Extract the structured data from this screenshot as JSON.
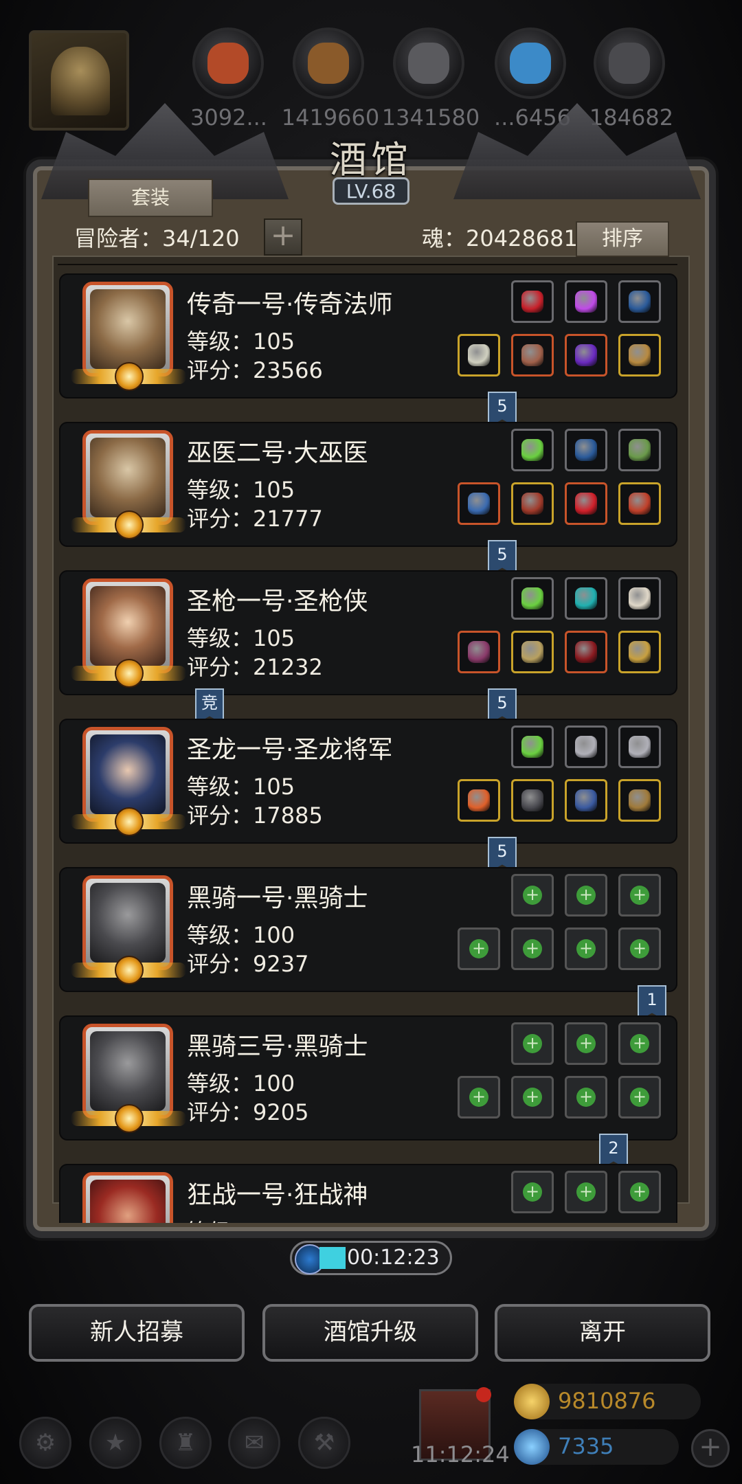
{
  "resources": {
    "values": [
      "3092...",
      "1419660",
      "1341580",
      "...6456",
      "184682"
    ],
    "colors": [
      "#b34a28",
      "#8a5a2a",
      "#5a5a5e",
      "#3c8ac8",
      "#4a4a4e"
    ]
  },
  "tavern": {
    "title": "酒馆",
    "level": "LV.68",
    "tab_label": "套装",
    "adventurer_count": "冒险者：34/120",
    "add_label": "+",
    "soul": "魂：20428681",
    "sort_label": "排序"
  },
  "heroes": [
    {
      "name": "传奇一号·传奇法师",
      "level": "等级：105",
      "score": "评分：23566",
      "face": "old-mage",
      "slots_top": [
        "ruby-necklace",
        "purple-gem",
        "blue-bow"
      ],
      "slots_bottom": [
        "silver-staff",
        "armor",
        "amulet",
        "ring"
      ],
      "ribbon_right": "5"
    },
    {
      "name": "巫医二号·大巫医",
      "level": "等级：105",
      "score": "评分：21777",
      "face": "old-mage",
      "slots_top": [
        "green-crystal",
        "blue-bow",
        "green-leaf"
      ],
      "slots_bottom": [
        "wand",
        "red-armor",
        "red-potion",
        "red-ring"
      ],
      "ribbon_right": "5"
    },
    {
      "name": "圣枪一号·圣枪侠",
      "level": "等级：105",
      "score": "评分：21232",
      "face": "gunslinger",
      "slots_top": [
        "green-crystal",
        "teal-stone",
        "white-feather"
      ],
      "slots_bottom": [
        "rifle",
        "helmet",
        "red-claw",
        "gold-ring"
      ],
      "ribbon_left": "竞",
      "ribbon_right": "5"
    },
    {
      "name": "圣龙一号·圣龙将军",
      "level": "等级：105",
      "score": "评分：17885",
      "face": "general",
      "slots_top": [
        "green-crystal",
        "dagger",
        "dagger"
      ],
      "slots_bottom": [
        "flame-sword",
        "dark-armor",
        "pendant",
        "shield"
      ],
      "ribbon_right": "5"
    },
    {
      "name": "黑骑一号·黑骑士",
      "level": "等级：100",
      "score": "评分：9237",
      "face": "knight",
      "empty": true,
      "ribbon_right": "1"
    },
    {
      "name": "黑骑三号·黑骑士",
      "level": "等级：100",
      "score": "评分：9205",
      "face": "knight",
      "empty": true,
      "ribbon_right": "2"
    },
    {
      "name": "狂战一号·狂战神",
      "level": "等级：",
      "score": "",
      "face": "berserker",
      "empty": true
    }
  ],
  "timer": "00:12:23",
  "actions": {
    "recruit": "新人招募",
    "upgrade": "酒馆升级",
    "leave": "离开"
  },
  "bottom": {
    "clock": "11:12:24",
    "gold": "9810876",
    "gems": "7335",
    "icons": [
      "settings-icon",
      "star-icon",
      "castle-icon",
      "mail-icon",
      "forge-icon"
    ]
  }
}
